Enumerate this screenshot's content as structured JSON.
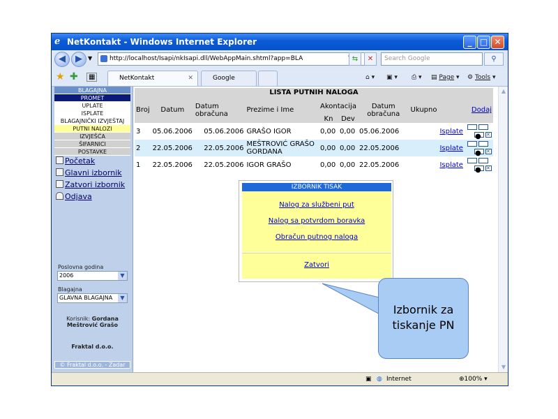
{
  "window": {
    "title": "NetKontakt - Windows Internet Explorer"
  },
  "browser": {
    "address": "http://localhost/Isapi/nkIsapi.dll/WebAppMain.shtml?app=BLA",
    "search_placeholder": "Search Google",
    "tabs": [
      {
        "label": "NetKontakt"
      },
      {
        "label": "Google"
      }
    ],
    "toolbar": {
      "page_label": "Page",
      "tools_label": "Tools"
    },
    "status": {
      "zone": "Internet",
      "zoom": "100%"
    }
  },
  "sidebar": {
    "menu": [
      "BLAGAJNA",
      "PROMET",
      "UPLATE",
      "ISPLATE",
      "BLAGAJNIČKI IZVJEŠTAJ",
      "PUTNI NALOZI",
      "IZVJEŠĆA",
      "ŠIFARNICI",
      "POSTAVKE"
    ],
    "links": [
      "Početak",
      "Glavni izbornik",
      "Zatvori izbornik",
      "Odjava"
    ],
    "year_label": "Poslovna godina",
    "year_value": "2006",
    "cash_label": "Blagajna",
    "cash_value": "GLAVNA BLAGAJNA",
    "user_label": "Korisnik:",
    "user_name": "Gordana Meštrović Grašo",
    "company": "Fraktal d.o.o.",
    "footer": "© Fraktal d.o.o. - Zadar"
  },
  "list": {
    "title": "LISTA PUTNIH NALOGA",
    "headers": {
      "broj": "Broj",
      "datum": "Datum",
      "datum_obracuna": "Datum obračuna",
      "prezime": "Prezime i Ime",
      "akontacija": "Akontacija",
      "kn": "Kn",
      "dev": "Dev",
      "datum_obracuna2": "Datum obračuna",
      "ukupno": "Ukupno",
      "dodaj": "Dodaj"
    },
    "rows": [
      {
        "broj": "3",
        "datum": "05.06.2006",
        "obracun": "05.06.2006",
        "ime": "GRAŠO IGOR",
        "kn": "0,00",
        "dev": "0,00",
        "obracun2": "05.06.2006",
        "action": "Isplate"
      },
      {
        "broj": "2",
        "datum": "22.05.2006",
        "obracun": "22.05.2006",
        "ime": "MEŠTROVIĆ GRAŠO GORDANA",
        "kn": "0,00",
        "dev": "0,00",
        "obracun2": "22.05.2006",
        "action": "Isplate"
      },
      {
        "broj": "1",
        "datum": "22.05.2006",
        "obracun": "22.05.2006",
        "ime": "IGOR GRAŠO",
        "kn": "0,00",
        "dev": "0,00",
        "obracun2": "22.05.2006",
        "action": "Isplate"
      }
    ]
  },
  "popup": {
    "title": "IZBORNIK TISAK",
    "items": [
      "Nalog za službeni put",
      "Nalog sa potvrdom boravka",
      "Obračun putnog naloga"
    ],
    "close": "Zatvori"
  },
  "callout": {
    "line1": "Izbornik za",
    "line2": "tiskanje PN"
  },
  "colors": {
    "accent": "#1f68d8",
    "popup_bg": "#ffff99",
    "row_highlight": "#d9eefb",
    "callout": "#a8ccf4"
  }
}
